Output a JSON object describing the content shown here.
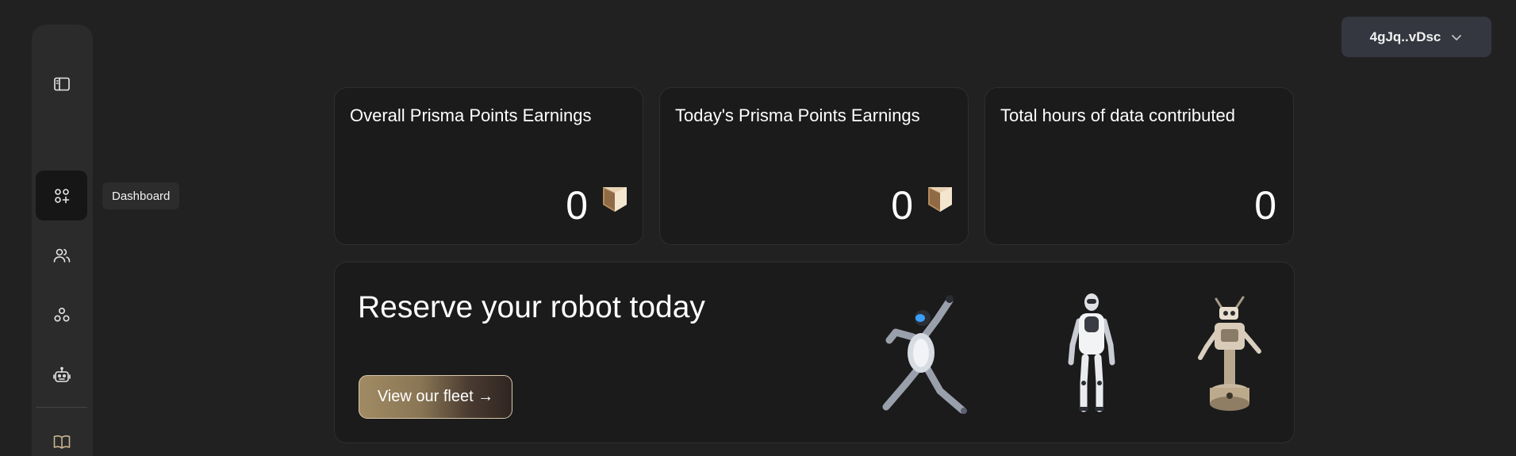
{
  "sidebar": {
    "items": [
      {
        "icon": "panel-toggle-icon"
      },
      {
        "icon": "dashboard-icon",
        "tooltip": "Dashboard",
        "active": true
      },
      {
        "icon": "users-icon"
      },
      {
        "icon": "nodes-icon"
      },
      {
        "icon": "robot-icon"
      },
      {
        "icon": "book-icon",
        "accent": "#c9b48e"
      }
    ]
  },
  "tooltip": {
    "label": "Dashboard"
  },
  "wallet": {
    "address": "4gJq..vDsc",
    "icon": "chevron-down-icon"
  },
  "stats": [
    {
      "title": "Overall Prisma Points Earnings",
      "value": "0",
      "icon": "prisma-token-icon"
    },
    {
      "title": "Today's Prisma Points Earnings",
      "value": "0",
      "icon": "prisma-token-icon"
    },
    {
      "title": "Total hours of data contributed",
      "value": "0"
    }
  ],
  "banner": {
    "title": "Reserve your robot today",
    "cta_label": "View our fleet →",
    "robots": [
      "running-humanoid-robot",
      "standing-humanoid-robot",
      "wheeled-robot"
    ]
  },
  "colors": {
    "background": "#212121",
    "card": "#1b1b1b",
    "sidebar": "#2b2b2b",
    "wallet": "#343740",
    "accent_gold": "#a08b63"
  }
}
